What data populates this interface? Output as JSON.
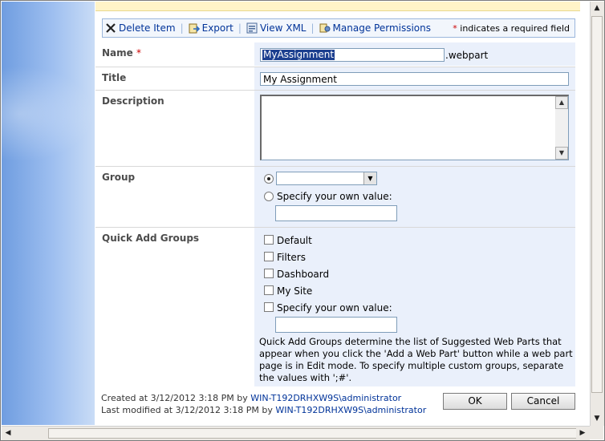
{
  "toolbar": {
    "delete_label": "Delete Item",
    "export_label": "Export",
    "viewxml_label": "View XML",
    "permissions_label": "Manage Permissions",
    "required_star": "*",
    "required_note": " indicates a required field"
  },
  "form": {
    "name": {
      "label": "Name",
      "star": "*",
      "value": "MyAssignment",
      "suffix": ".webpart"
    },
    "title": {
      "label": "Title",
      "value": "My Assignment"
    },
    "description": {
      "label": "Description",
      "value": ""
    },
    "group": {
      "label": "Group",
      "dropdown_value": "",
      "specify_label": "Specify your own value:",
      "specify_value": ""
    },
    "quick_add": {
      "label": "Quick Add Groups",
      "options": [
        "Default",
        "Filters",
        "Dashboard",
        "My Site",
        "Specify your own value:"
      ],
      "specify_value": "",
      "help": "Quick Add Groups determine the list of Suggested Web Parts that appear when you click the 'Add a Web Part' button while a web part page is in Edit mode. To specify multiple custom groups, separate the values with ';#'."
    }
  },
  "footer": {
    "created_prefix": "Created at 3/12/2012 3:18 PM  by ",
    "created_by": "WIN-T192DRHXW9S\\administrator",
    "modified_prefix": "Last modified at 3/12/2012 3:18 PM  by ",
    "modified_by": "WIN-T192DRHXW9S\\administrator"
  },
  "buttons": {
    "ok": "OK",
    "cancel": "Cancel"
  },
  "colors": {
    "link": "#003399",
    "required": "#cc0000",
    "field_bg": "#eaf0fb",
    "left_pane": "#9ebff0"
  }
}
